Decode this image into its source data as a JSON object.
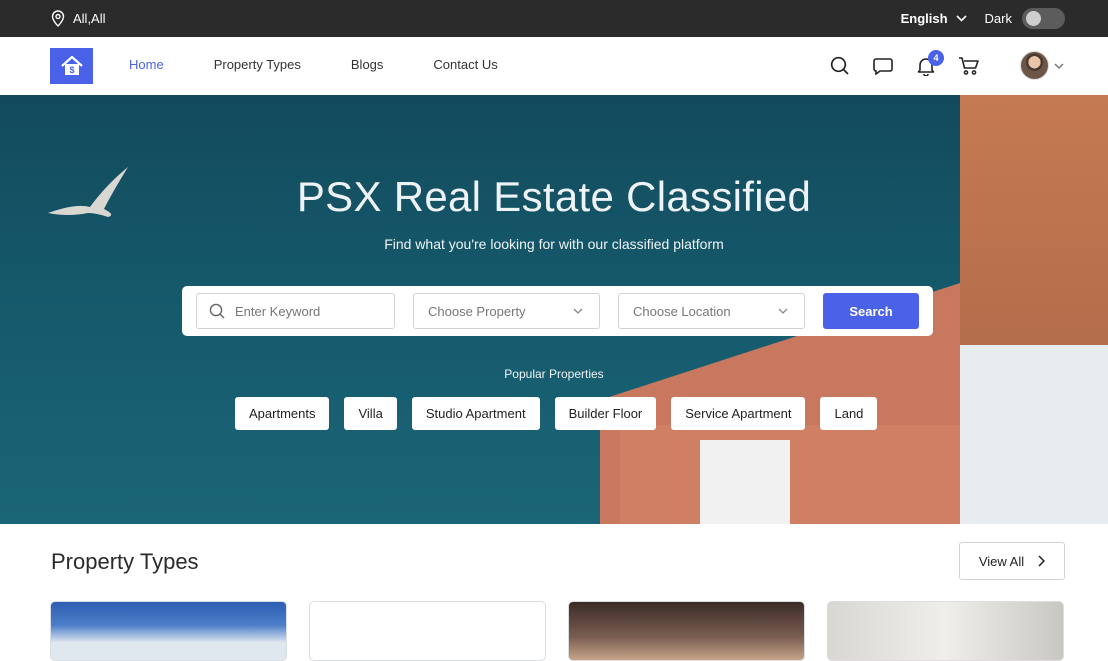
{
  "topbar": {
    "location": "All,All",
    "language": "English",
    "theme_label": "Dark"
  },
  "nav": {
    "links": [
      "Home",
      "Property Types",
      "Blogs",
      "Contact Us"
    ],
    "notification_count": "4"
  },
  "hero": {
    "title": "PSX Real Estate Classified",
    "subtitle": "Find what you're looking for with our classified platform",
    "search": {
      "keyword_placeholder": "Enter Keyword",
      "property_select": "Choose Property",
      "location_select": "Choose Location",
      "button": "Search"
    },
    "popular_label": "Popular Properties",
    "popular_chips": [
      "Apartments",
      "Villa",
      "Studio Apartment",
      "Builder Floor",
      "Service Apartment",
      "Land"
    ]
  },
  "property_types": {
    "title": "Property Types",
    "view_all": "View All"
  },
  "colors": {
    "accent": "#4a62e8",
    "topbar": "#2b2b2b",
    "hero": "#15596b"
  }
}
